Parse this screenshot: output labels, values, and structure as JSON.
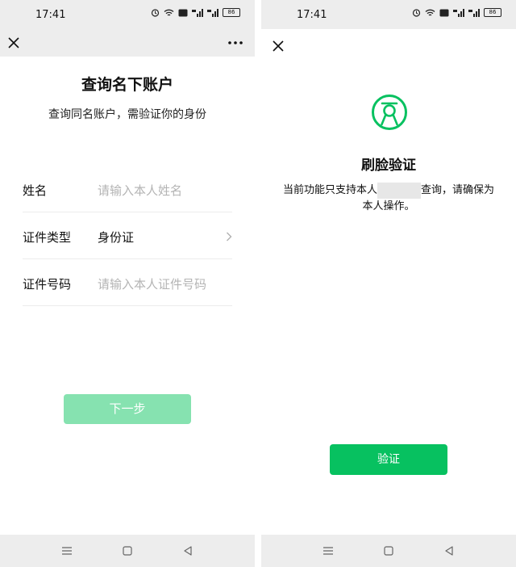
{
  "status_bar": {
    "time": "17:41",
    "battery": "86"
  },
  "left_screen": {
    "title": "查询名下账户",
    "subtitle": "查询同名账户，需验证你的身份",
    "form": {
      "name_label": "姓名",
      "name_placeholder": "请输入本人姓名",
      "id_type_label": "证件类型",
      "id_type_value": "身份证",
      "id_number_label": "证件号码",
      "id_number_placeholder": "请输入本人证件号码"
    },
    "next_button": "下一步"
  },
  "right_screen": {
    "title": "刷脸验证",
    "description_part1": "当前功能只支持本人",
    "description_part2": "查询，请确保为本人操作。",
    "verify_button": "验证"
  },
  "icons": {
    "close": "close-icon",
    "more": "more-icon",
    "chevron": "chevron-right-icon",
    "face": "face-verification-icon",
    "nav_menu": "menu-icon",
    "nav_home": "home-icon",
    "nav_back": "back-icon"
  },
  "colors": {
    "brand_green": "#07c160",
    "disabled_green": "#86e2b0",
    "bar_gray": "#ededed"
  }
}
